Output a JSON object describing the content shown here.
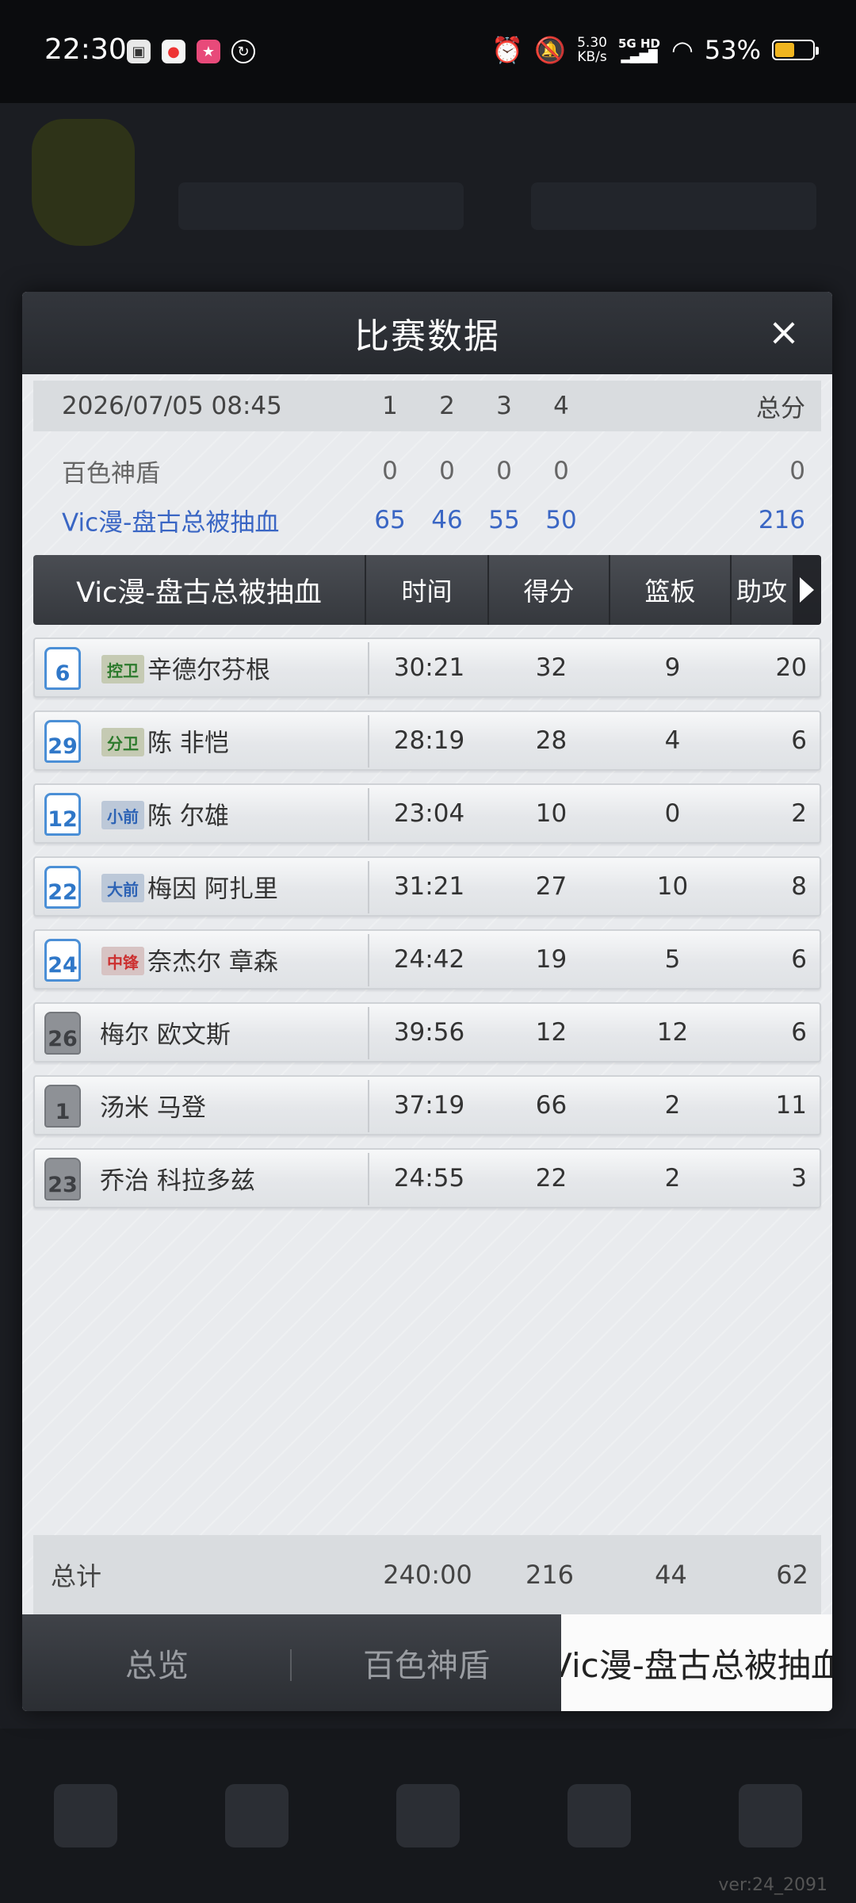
{
  "status_bar": {
    "time": "22:30",
    "speed_value": "5.30",
    "speed_unit": "KB/s",
    "network": "5G HD",
    "battery": "53%",
    "battery_level": 0.53
  },
  "background": {
    "version": "ver:24_2091"
  },
  "modal": {
    "title": "比赛数据",
    "close_icon": "×",
    "score": {
      "date": "2026/07/05 08:45",
      "quarters": [
        "1",
        "2",
        "3",
        "4"
      ],
      "total_label": "总分",
      "teams": [
        {
          "name": "百色神盾",
          "q": [
            "0",
            "0",
            "0",
            "0"
          ],
          "total": "0",
          "color": "#666666"
        },
        {
          "name": "Vic漫-盘古总被抽血",
          "q": [
            "65",
            "46",
            "55",
            "50"
          ],
          "total": "216",
          "color": "#3a66c4"
        }
      ]
    },
    "table": {
      "team_name": "Vic漫-盘古总被抽血",
      "columns": {
        "time": "时间",
        "points": "得分",
        "rebounds": "篮板",
        "assists": "助攻"
      },
      "players": [
        {
          "number": "6",
          "position": "控卫",
          "name": "辛德尔芬根",
          "time": "30:21",
          "points": "32",
          "rebounds": "9",
          "assists": "20"
        },
        {
          "number": "29",
          "position": "分卫",
          "name": "陈 非恺",
          "time": "28:19",
          "points": "28",
          "rebounds": "4",
          "assists": "6"
        },
        {
          "number": "12",
          "position": "小前",
          "name": "陈 尔雄",
          "time": "23:04",
          "points": "10",
          "rebounds": "0",
          "assists": "2"
        },
        {
          "number": "22",
          "position": "大前",
          "name": "梅因 阿扎里",
          "time": "31:21",
          "points": "27",
          "rebounds": "10",
          "assists": "8"
        },
        {
          "number": "24",
          "position": "中锋",
          "name": "奈杰尔 章森",
          "time": "24:42",
          "points": "19",
          "rebounds": "5",
          "assists": "6"
        },
        {
          "number": "26",
          "position": "",
          "name": "梅尔 欧文斯",
          "time": "39:56",
          "points": "12",
          "rebounds": "12",
          "assists": "6"
        },
        {
          "number": "1",
          "position": "",
          "name": "汤米 马登",
          "time": "37:19",
          "points": "66",
          "rebounds": "2",
          "assists": "11"
        },
        {
          "number": "23",
          "position": "",
          "name": "乔治 科拉多兹",
          "time": "24:55",
          "points": "22",
          "rebounds": "2",
          "assists": "3"
        }
      ],
      "totals": {
        "label": "总计",
        "time": "240:00",
        "points": "216",
        "rebounds": "44",
        "assists": "62"
      }
    },
    "tabs": [
      "总览",
      "百色神盾",
      "Vic漫-盘古总被抽血"
    ]
  }
}
